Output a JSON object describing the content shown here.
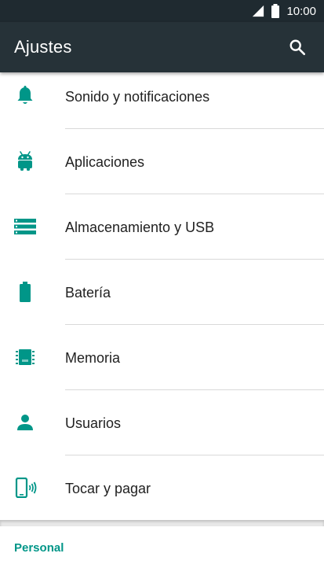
{
  "status_bar": {
    "time": "10:00",
    "icons": [
      "signal-icon",
      "battery-icon"
    ]
  },
  "app_bar": {
    "title": "Ajustes",
    "search_icon": "search-icon"
  },
  "settings": {
    "items": [
      {
        "label": "Sonido y notificaciones",
        "icon": "bell-icon"
      },
      {
        "label": "Aplicaciones",
        "icon": "android-icon"
      },
      {
        "label": "Almacenamiento y USB",
        "icon": "storage-icon"
      },
      {
        "label": "Batería",
        "icon": "battery-icon"
      },
      {
        "label": "Memoria",
        "icon": "memory-chip-icon"
      },
      {
        "label": "Usuarios",
        "icon": "person-icon"
      },
      {
        "label": "Tocar y pagar",
        "icon": "tap-and-pay-icon"
      }
    ]
  },
  "section": {
    "header": "Personal"
  },
  "colors": {
    "app_bar": "#263238",
    "status_bar": "#1f2a30",
    "accent": "#009688",
    "text": "#212121"
  }
}
